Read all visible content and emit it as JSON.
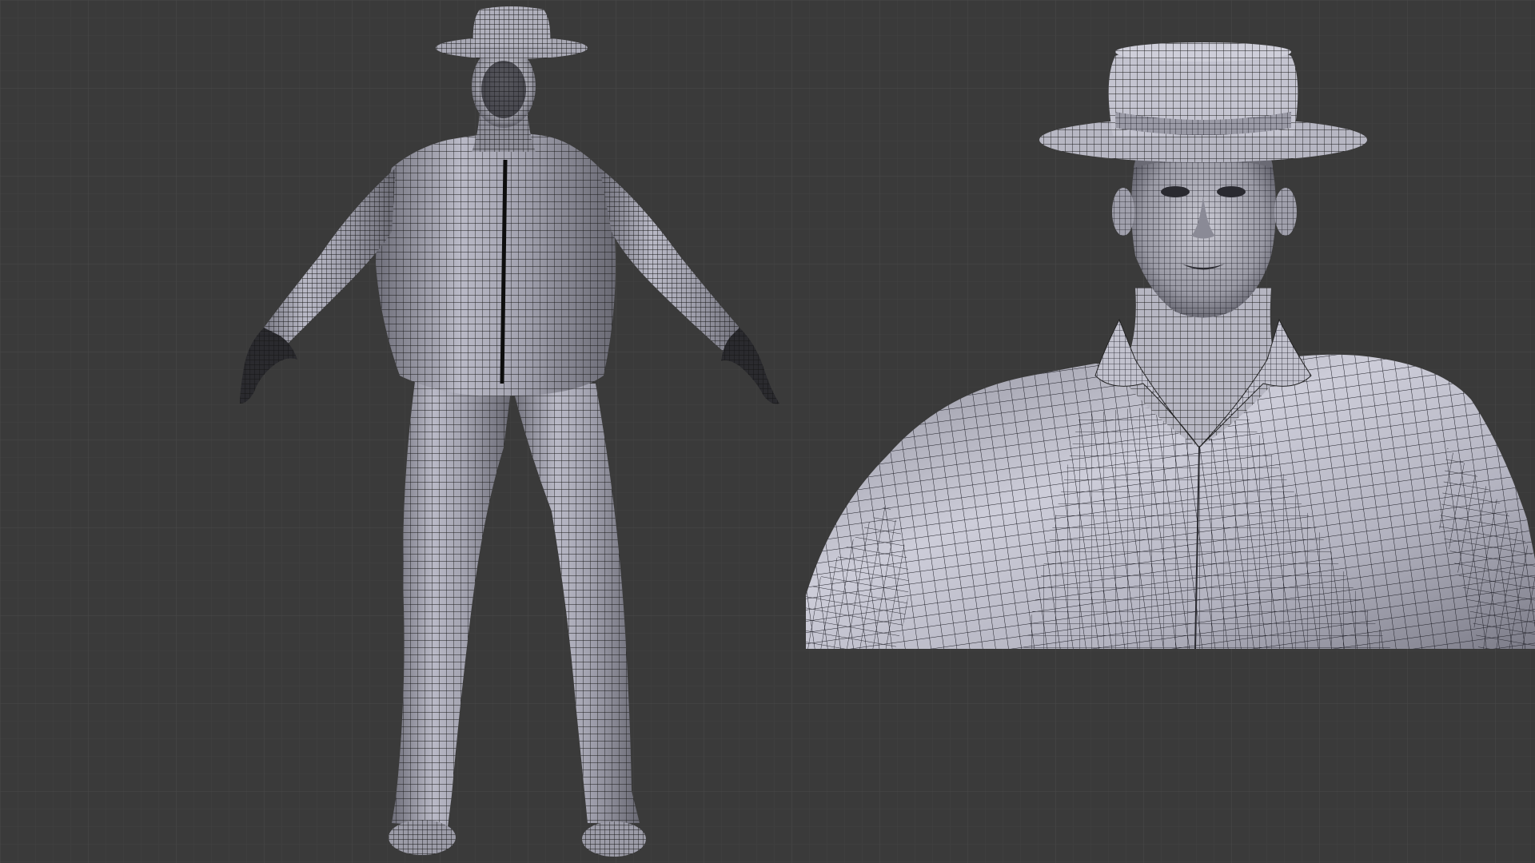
{
  "viewport": {
    "background": "#3a3a3a",
    "grid_minor_color": "#424242",
    "grid_major_color": "#464646",
    "mesh_fill": "#a9a9b4",
    "mesh_fill_light": "#c9c9d6",
    "mesh_fill_shadow": "#6e6e78",
    "wire_color": "#1a1a1a"
  },
  "views": [
    {
      "name": "full-body-front-wireframe",
      "subject": "character-full-body",
      "pose": "A-pose"
    },
    {
      "name": "upper-body-closeup-wireframe",
      "subject": "character-head-torso"
    }
  ]
}
